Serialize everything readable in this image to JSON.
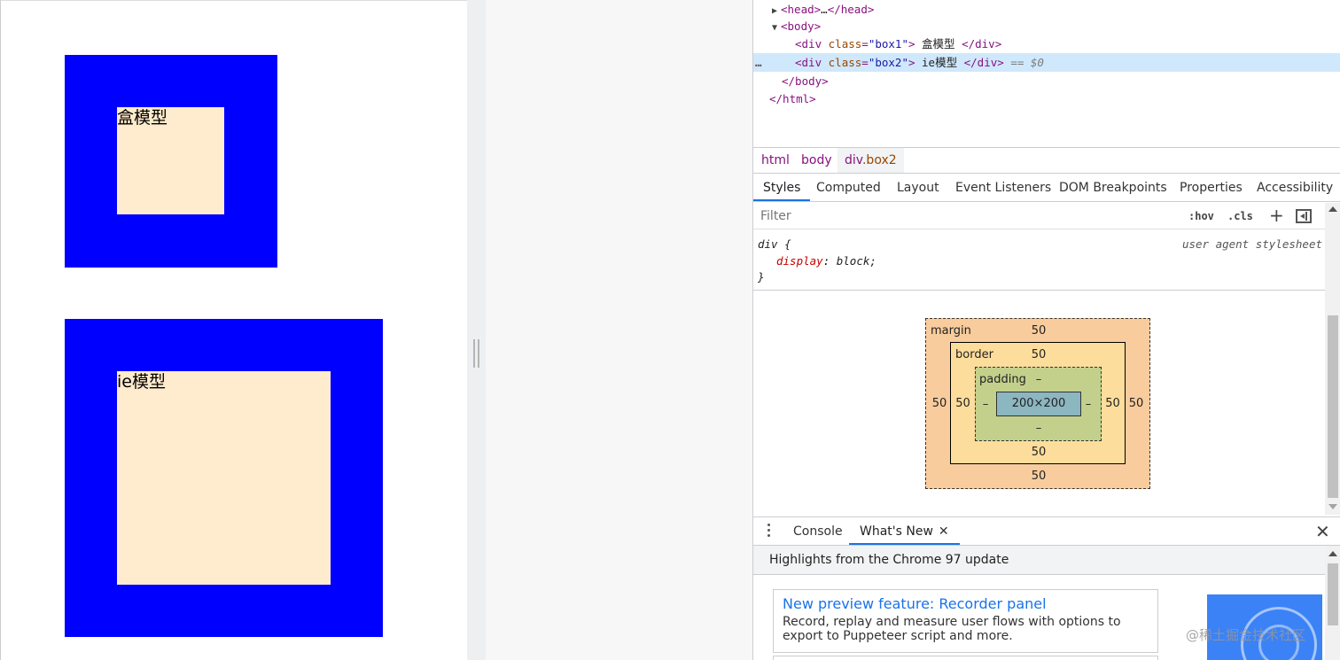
{
  "page": {
    "box1_text": "盒模型",
    "box2_text": "ie模型",
    "colors": {
      "border": "#0000ff",
      "content": "#ffebcd"
    }
  },
  "dom_tree": {
    "head": {
      "open": "<head>",
      "ellipsis": "…",
      "close": "</head>"
    },
    "body_open": "<body>",
    "body_close": "</body>",
    "html_close": "</html>",
    "div_open": "<div",
    "div_close": "</div>",
    "class_attr": "class",
    "box1_class": "\"box1\"",
    "box1_text": "盒模型",
    "box2_class": "\"box2\"",
    "box2_text": "ie模型",
    "selected_marker": "== $0",
    "dots": "…"
  },
  "breadcrumb": {
    "items": [
      "html",
      "body"
    ],
    "active_tag": "div",
    "active_class": ".box2"
  },
  "styles_tabs": [
    "Styles",
    "Computed",
    "Layout",
    "Event Listeners",
    "DOM Breakpoints",
    "Properties",
    "Accessibility"
  ],
  "filter": {
    "placeholder": "Filter",
    "hov": ":hov",
    "cls": ".cls",
    "add": "+"
  },
  "css_rule": {
    "selector": "div {",
    "origin": "user agent stylesheet",
    "property": "display",
    "value": "block;",
    "close": "}"
  },
  "box_model": {
    "margin_label": "margin",
    "margin_top": "50",
    "margin_right": "50",
    "margin_bottom": "50",
    "margin_left": "50",
    "border_label": "border",
    "border_top": "50",
    "border_right": "50",
    "border_bottom": "50",
    "border_left": "50",
    "padding_label": "padding",
    "padding_top": "–",
    "padding_right": "–",
    "padding_bottom": "–",
    "padding_left": "–",
    "content_size": "200×200"
  },
  "drawer": {
    "tabs": [
      "Console",
      "What's New"
    ],
    "close_tab": "✕",
    "close_drawer": "✕",
    "header": "Highlights from the Chrome 97 update",
    "feature_title": "New preview feature: Recorder panel",
    "feature_desc": "Record, replay and measure user flows with options to export to Puppeteer script and more.",
    "watermark": "@稀土掘金技术社区"
  }
}
